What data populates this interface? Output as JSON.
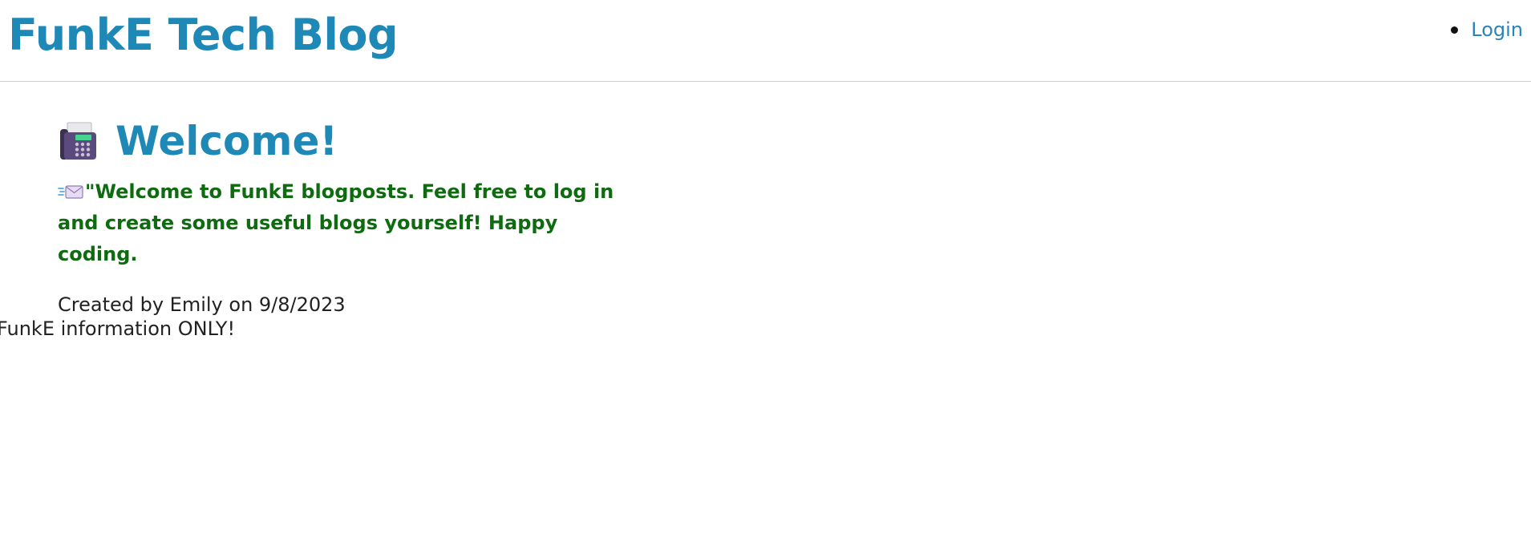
{
  "header": {
    "site_title": "FunkE Tech Blog",
    "nav": [
      {
        "label": "Login"
      }
    ]
  },
  "post": {
    "icon": "fax-icon",
    "title": "Welcome!",
    "body_icon": "incoming-envelope-icon",
    "body": "\"Welcome to FunkE blogposts. Feel free to log in and create some useful blogs yourself! Happy coding.",
    "meta": "Created by Emily on 9/8/2023"
  },
  "footer": {
    "note": "FunkE information ONLY!"
  },
  "colors": {
    "title_blue": "#1e88b7",
    "link_blue": "#2b83b9",
    "body_green": "#0f6b10",
    "divider": "#cfcfcf"
  }
}
